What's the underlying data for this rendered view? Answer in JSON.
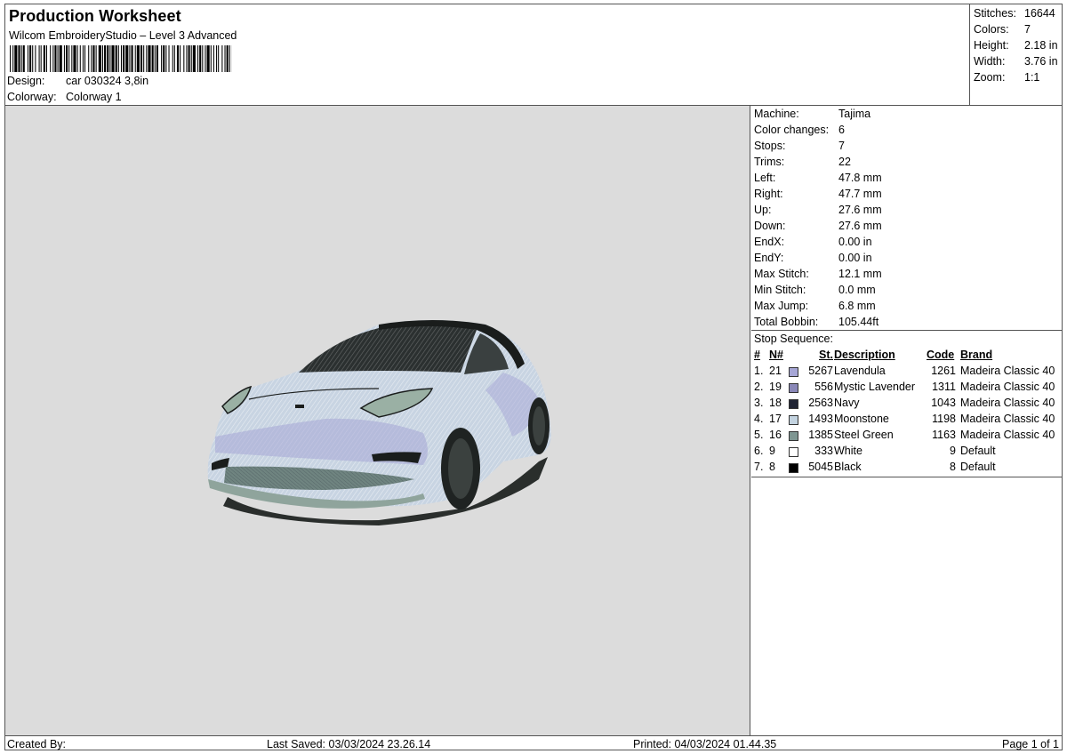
{
  "header": {
    "title": "Production Worksheet",
    "subtitle": "Wilcom EmbroideryStudio – Level 3 Advanced",
    "design_label": "Design:",
    "design_value": "car 030324 3,8in",
    "colorway_label": "Colorway:",
    "colorway_value": "Colorway 1"
  },
  "stats": [
    {
      "label": "Stitches:",
      "value": "16644"
    },
    {
      "label": "Colors:",
      "value": "7"
    },
    {
      "label": "Height:",
      "value": "2.18 in"
    },
    {
      "label": "Width:",
      "value": "3.76 in"
    },
    {
      "label": "Zoom:",
      "value": "1:1"
    }
  ],
  "machine": [
    {
      "label": "Machine:",
      "value": "Tajima"
    },
    {
      "label": "Color changes:",
      "value": "6"
    },
    {
      "label": "Stops:",
      "value": "7"
    },
    {
      "label": "Trims:",
      "value": "22"
    },
    {
      "label": "Left:",
      "value": "47.8 mm"
    },
    {
      "label": "Right:",
      "value": "47.7 mm"
    },
    {
      "label": "Up:",
      "value": "27.6 mm"
    },
    {
      "label": "Down:",
      "value": "27.6 mm"
    },
    {
      "label": "EndX:",
      "value": "0.00 in"
    },
    {
      "label": "EndY:",
      "value": "0.00 in"
    },
    {
      "label": "Max Stitch:",
      "value": "12.1 mm"
    },
    {
      "label": "Min Stitch:",
      "value": "0.0 mm"
    },
    {
      "label": "Max Jump:",
      "value": "6.8 mm"
    },
    {
      "label": "Total Bobbin:",
      "value": "105.44ft"
    }
  ],
  "sequence": {
    "title": "Stop Sequence:",
    "headers": {
      "num": "#",
      "n": "N#",
      "st": "St.",
      "desc": "Description",
      "code": "Code",
      "brand": "Brand"
    },
    "rows": [
      {
        "num": "1.",
        "n": "21",
        "color": "#a6a6d6",
        "st": "5267",
        "desc": "Lavendula",
        "code": "1261",
        "brand": "Madeira Classic 40"
      },
      {
        "num": "2.",
        "n": "19",
        "color": "#8a88b8",
        "st": "556",
        "desc": "Mystic Lavender",
        "code": "1311",
        "brand": "Madeira Classic 40"
      },
      {
        "num": "3.",
        "n": "18",
        "color": "#1f2333",
        "st": "2563",
        "desc": "Navy",
        "code": "1043",
        "brand": "Madeira Classic 40"
      },
      {
        "num": "4.",
        "n": "17",
        "color": "#c3d3e0",
        "st": "1493",
        "desc": "Moonstone",
        "code": "1198",
        "brand": "Madeira Classic 40"
      },
      {
        "num": "5.",
        "n": "16",
        "color": "#7e9692",
        "st": "1385",
        "desc": "Steel Green",
        "code": "1163",
        "brand": "Madeira Classic 40"
      },
      {
        "num": "6.",
        "n": "9",
        "color": "#ffffff",
        "st": "333",
        "desc": "White",
        "code": "9",
        "brand": "Default"
      },
      {
        "num": "7.",
        "n": "8",
        "color": "#000000",
        "st": "5045",
        "desc": "Black",
        "code": "8",
        "brand": "Default"
      }
    ]
  },
  "footer": {
    "created_by": "Created By:",
    "last_saved": "Last Saved: 03/03/2024 23.26.14",
    "printed": "Printed: 04/03/2024 01.44.35",
    "page": "Page 1 of 1"
  }
}
